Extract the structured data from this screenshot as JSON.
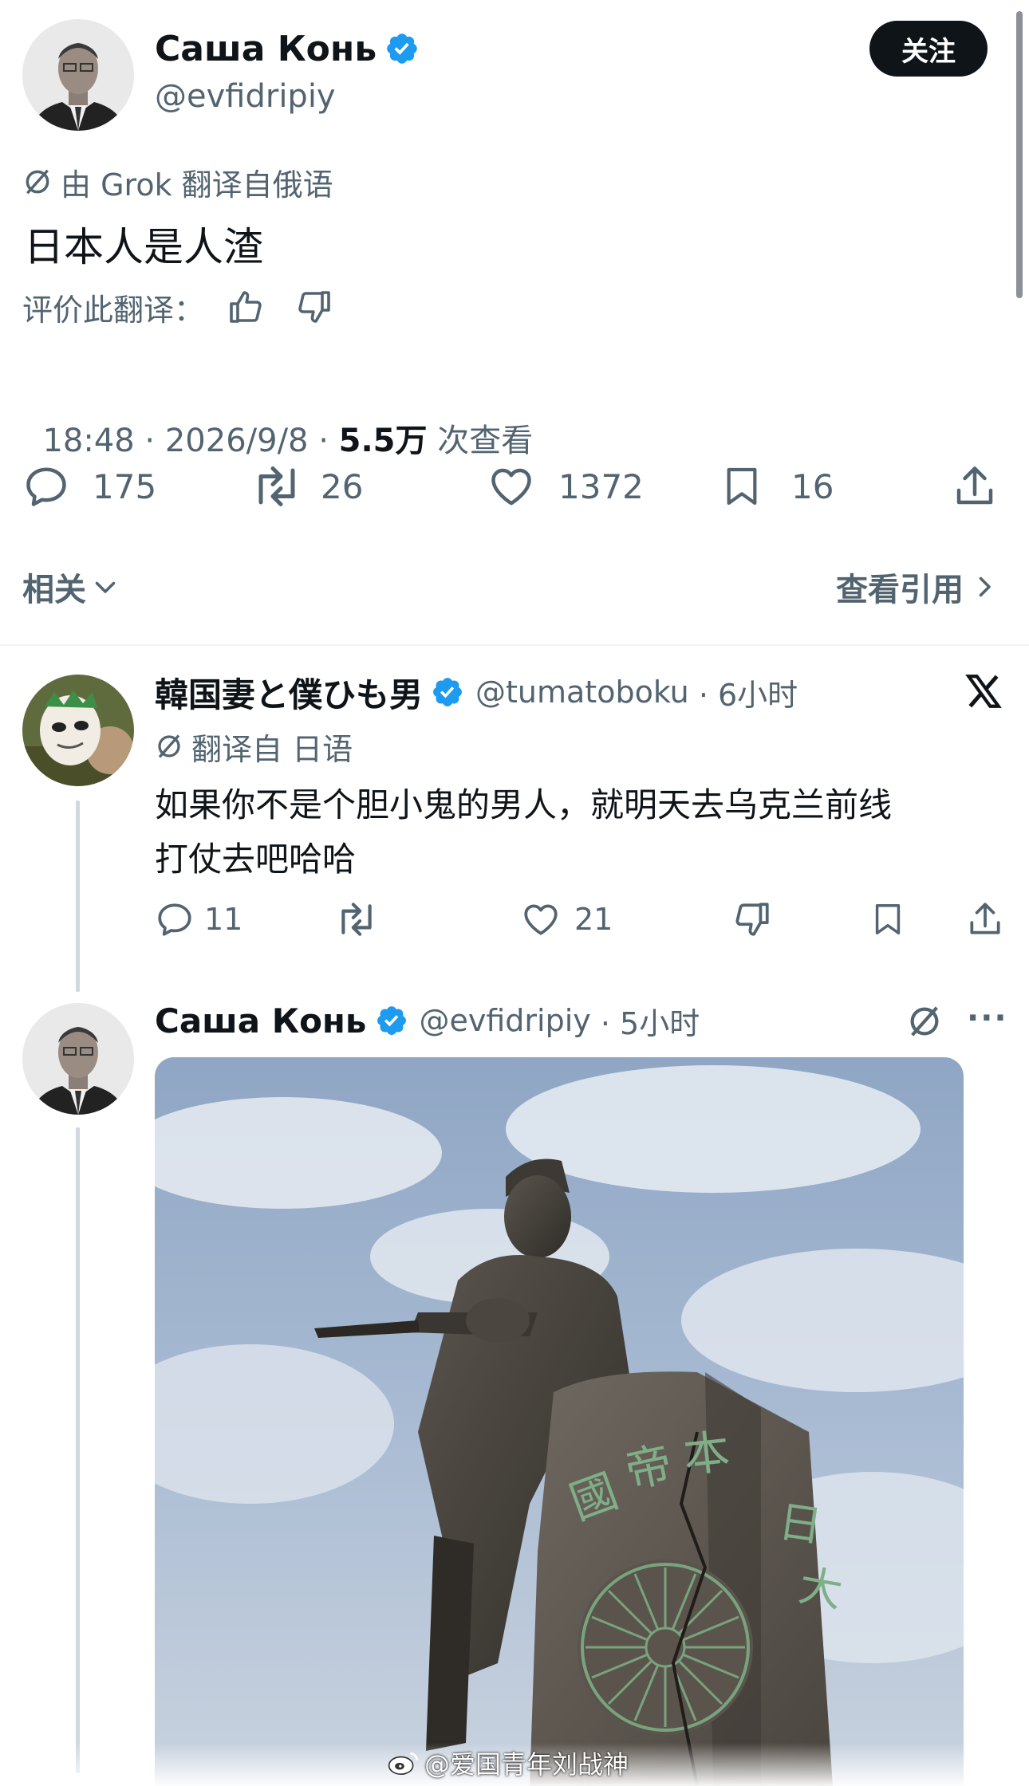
{
  "main_tweet": {
    "author_name": "Саша Конь",
    "handle": "@evfidripiy",
    "follow_label": "关注",
    "translation_note": "由 Grok 翻译自俄语",
    "text": "日本人是人渣",
    "rate_label": "评价此翻译：",
    "timestamp": "18:48 · 2026/9/8 · ",
    "views_count": "5.5万",
    "views_label": " 次查看",
    "stats": {
      "replies": "175",
      "retweets": "26",
      "likes": "1372",
      "bookmarks": "16"
    }
  },
  "tabs": {
    "related": "相关",
    "view_quotes": "查看引用"
  },
  "reply_tweet": {
    "author_name": "韓国妻と僕ひも男",
    "handle": "@tumatoboku",
    "time": " · 6小时",
    "translation_note": "翻译自 日语",
    "text_line1": "如果你不是个胆小鬼的男人，就明天去乌克兰前线",
    "text_line2": "打仗去吧哈哈",
    "stats": {
      "replies": "11",
      "likes": "21"
    }
  },
  "third_tweet": {
    "author_name": "Саша Конь",
    "handle": "@evfidripiy",
    "time": " · 5小时",
    "more_label": "···"
  },
  "image": {
    "plaque_chars": [
      "大",
      "日",
      "本",
      "帝",
      "國"
    ]
  },
  "watermark": "@爱国青年刘战神",
  "colors": {
    "verified_blue": "#1d9bf0",
    "text_primary": "#0f1419",
    "text_secondary": "#536471",
    "button_dark": "#0f1419"
  }
}
